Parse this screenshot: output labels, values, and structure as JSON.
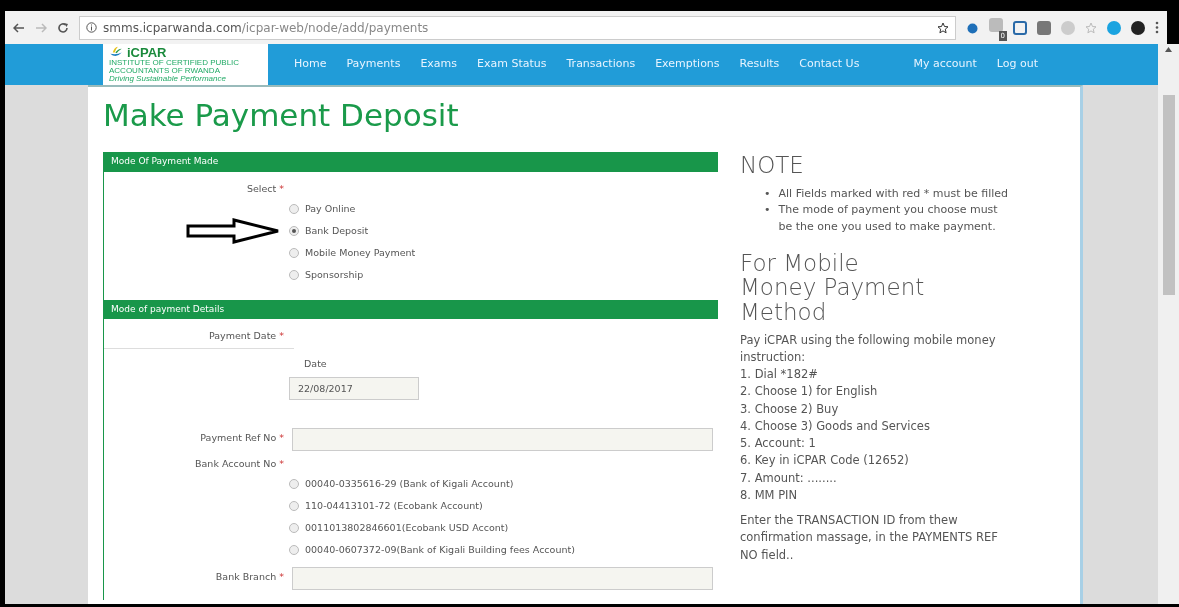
{
  "browser": {
    "url_host": "smms.icparwanda.com",
    "url_path": "/icpar-web/node/add/payments",
    "extension_badge": "0"
  },
  "site": {
    "logo": "iCPAR",
    "logo_subtitle": "INSTITUTE OF CERTIFIED PUBLIC ACCOUNTANTS OF RWANDA",
    "tagline": "Driving Sustainable Performance",
    "nav": [
      {
        "label": "Home"
      },
      {
        "label": "Payments"
      },
      {
        "label": "Exams"
      },
      {
        "label": "Exam Status"
      },
      {
        "label": "Transactions"
      },
      {
        "label": "Exemptions"
      },
      {
        "label": "Results"
      },
      {
        "label": "Contact Us"
      }
    ],
    "account_nav": [
      {
        "label": "My account"
      },
      {
        "label": "Log out"
      }
    ]
  },
  "page": {
    "title": "Make Payment Deposit",
    "required_marker": "*"
  },
  "sections": [
    {
      "title": "Mode Of Payment Made",
      "fields": [
        {
          "kind": "radios",
          "label": "Select",
          "required": true,
          "options": [
            {
              "label": "Pay Online",
              "selected": false
            },
            {
              "label": "Bank Deposit",
              "selected": true
            },
            {
              "label": "Mobile Money Payment",
              "selected": false
            },
            {
              "label": "Sponsorship",
              "selected": false
            }
          ]
        }
      ]
    },
    {
      "title": "Mode of payment Details",
      "fields": [
        {
          "kind": "date",
          "label": "Payment Date",
          "required": true,
          "sublabel": "Date",
          "value": "22/08/2017"
        },
        {
          "kind": "text",
          "label": "Payment Ref No",
          "required": true
        },
        {
          "kind": "radios",
          "label": "Bank Account No",
          "required": true,
          "options": [
            {
              "label": "00040-0335616-29 (Bank of Kigali Account)",
              "selected": false
            },
            {
              "label": "110-04413101-72 (Ecobank Account)",
              "selected": false
            },
            {
              "label": "0011013802846601(Ecobank USD Accont)",
              "selected": false
            },
            {
              "label": "00040-0607372-09(Bank of Kigali Building fees Account)",
              "selected": false
            }
          ]
        },
        {
          "kind": "text",
          "label": "Bank Branch",
          "required": true
        }
      ]
    }
  ],
  "note": {
    "title": "NOTE",
    "bullet": "•",
    "items": [
      "All Fields marked with red * must be filled",
      "The mode of payment you choose must be the one you used to make payment."
    ],
    "mobile_title": "For Mobile Money Payment Method",
    "intro": "Pay iCPAR using the following mobile money instruction:",
    "steps": [
      "1. Dial *182#",
      "2. Choose 1) for English",
      "3. Choose 2) Buy",
      "4. Choose 3) Goods and Services",
      "5. Account: 1",
      "6. Key in iCPAR Code (12652)",
      "7. Amount: ........",
      "8. MM PIN"
    ],
    "footer": "Enter the TRANSACTION ID from thew confirmation massage, in the PAYMENTS REF NO field.."
  }
}
